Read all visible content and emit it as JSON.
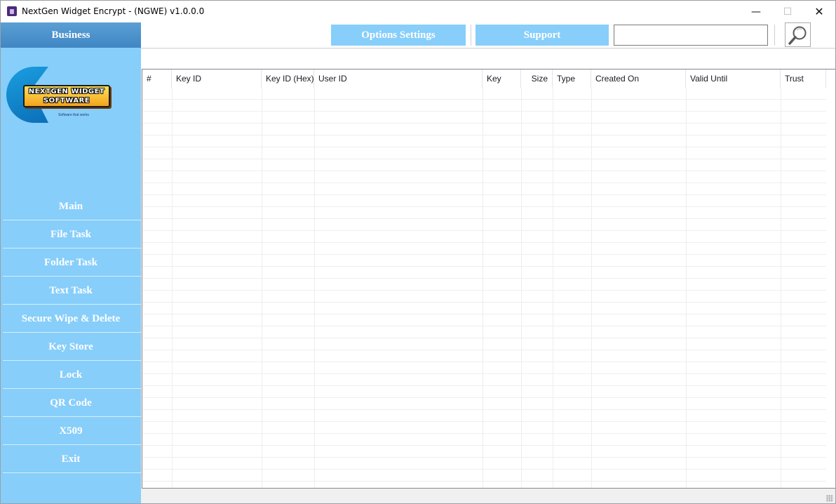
{
  "window": {
    "title": "NextGen Widget Encrypt - (NGWE) v1.0.0.0",
    "minimize_glyph": "—",
    "maximize_glyph": "☐",
    "close_glyph": "✕"
  },
  "sidebar": {
    "edition": "Business",
    "logo": {
      "line1": "NEXTGEN WIDGET",
      "line2": "SOFTWARE",
      "tagline": "Software that works"
    },
    "items": [
      {
        "label": "Main"
      },
      {
        "label": "File Task"
      },
      {
        "label": "Folder Task"
      },
      {
        "label": "Text Task"
      },
      {
        "label": "Secure Wipe & Delete"
      },
      {
        "label": "Key Store"
      },
      {
        "label": "Lock"
      },
      {
        "label": "QR Code"
      },
      {
        "label": "X509"
      },
      {
        "label": "Exit"
      }
    ]
  },
  "topbar": {
    "options_label": "Options Settings",
    "support_label": "Support",
    "search_value": "",
    "search_icon": "magnifier-icon"
  },
  "grid": {
    "columns": [
      "#",
      "Key ID",
      "Key ID (Hex)",
      "User ID",
      "Key",
      "Size",
      "Type",
      "Created On",
      "Valid Until",
      "Trust"
    ],
    "rows": []
  },
  "colors": {
    "sidebar": "#87cefa",
    "edition_header": "#3f86c4",
    "button": "#87cefa",
    "text_on_accent": "#ffffff"
  }
}
